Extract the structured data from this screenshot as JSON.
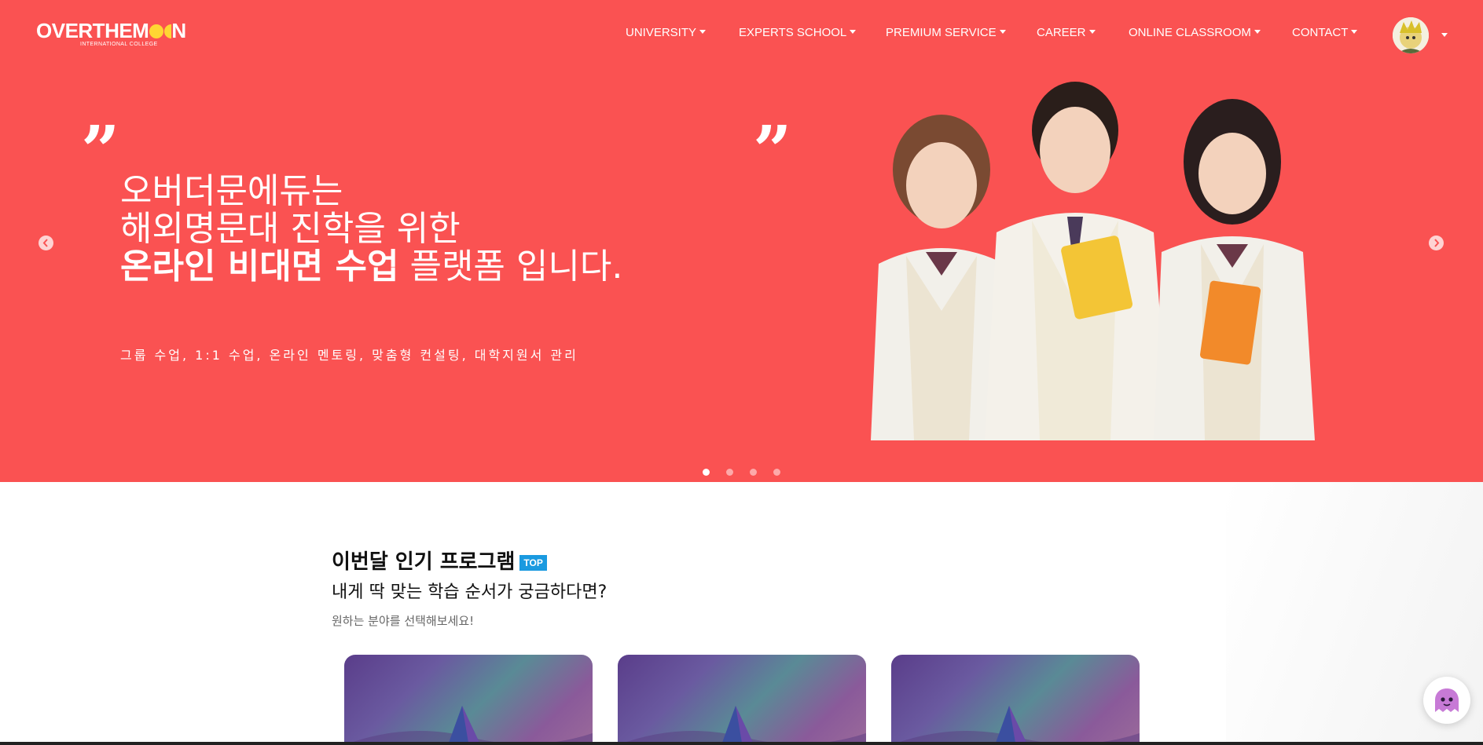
{
  "logo": {
    "main_prefix": "OVERTHEM",
    "main_suffix": "N",
    "sub": "INTERNATIONAL COLLEGE"
  },
  "nav": {
    "items": [
      {
        "label": "UNIVERSITY"
      },
      {
        "label": "EXPERTS SCHOOL"
      },
      {
        "label": "PREMIUM SERVICE"
      },
      {
        "label": "CAREER"
      },
      {
        "label": "ONLINE CLASSROOM"
      },
      {
        "label": "CONTACT"
      }
    ]
  },
  "hero": {
    "line1": "오버더문에듀는",
    "line2": "해외명문대 진학을 위한",
    "line3_bold": "온라인 비대면 수업",
    "line3_rest": " 플랫폼 입니다.",
    "subline": "그룹 수업, 1:1 수업, 온라인 멘토링, 맞춤형 컨설팅, 대학지원서 관리",
    "quote_open": "”",
    "quote_close": "”",
    "slide_count": 4,
    "active_slide": 1
  },
  "section": {
    "title": "이번달 인기 프로그램",
    "badge": "TOP",
    "subtitle": "내게 딱 맞는 학습 순서가 궁금하다면?",
    "description": "원하는 분야를 선택해보세요!"
  },
  "colors": {
    "hero_bg": "#fa5252",
    "badge": "#1a9ae0",
    "moon": "#ffd633"
  }
}
